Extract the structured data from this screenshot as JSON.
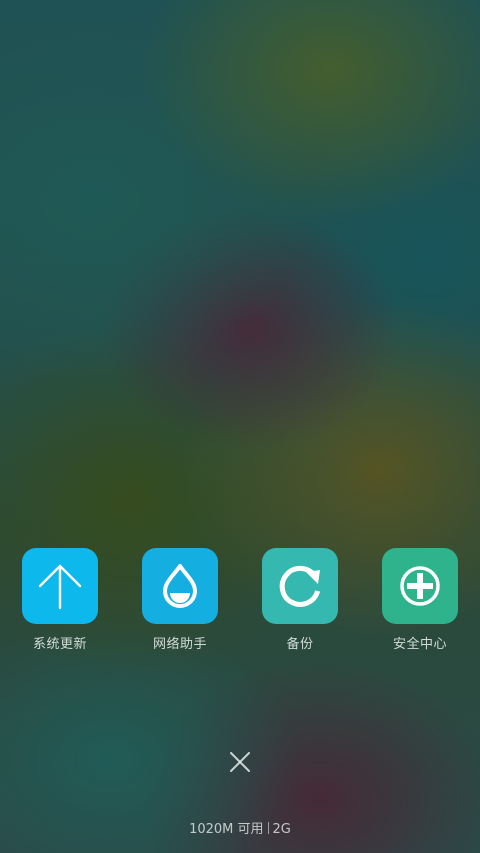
{
  "apps": [
    {
      "label": "系统更新",
      "icon": "arrow-up-icon",
      "color": "#0db8ed"
    },
    {
      "label": "网络助手",
      "icon": "water-drop-icon",
      "color": "#15aee0"
    },
    {
      "label": "备份",
      "icon": "refresh-circle-icon",
      "color": "#35b8b0"
    },
    {
      "label": "安全中心",
      "icon": "shield-cross-icon",
      "color": "#2fb38c"
    }
  ],
  "close": {
    "icon": "close-icon"
  },
  "status": {
    "memory": "1020M 可用",
    "network": "2G"
  }
}
